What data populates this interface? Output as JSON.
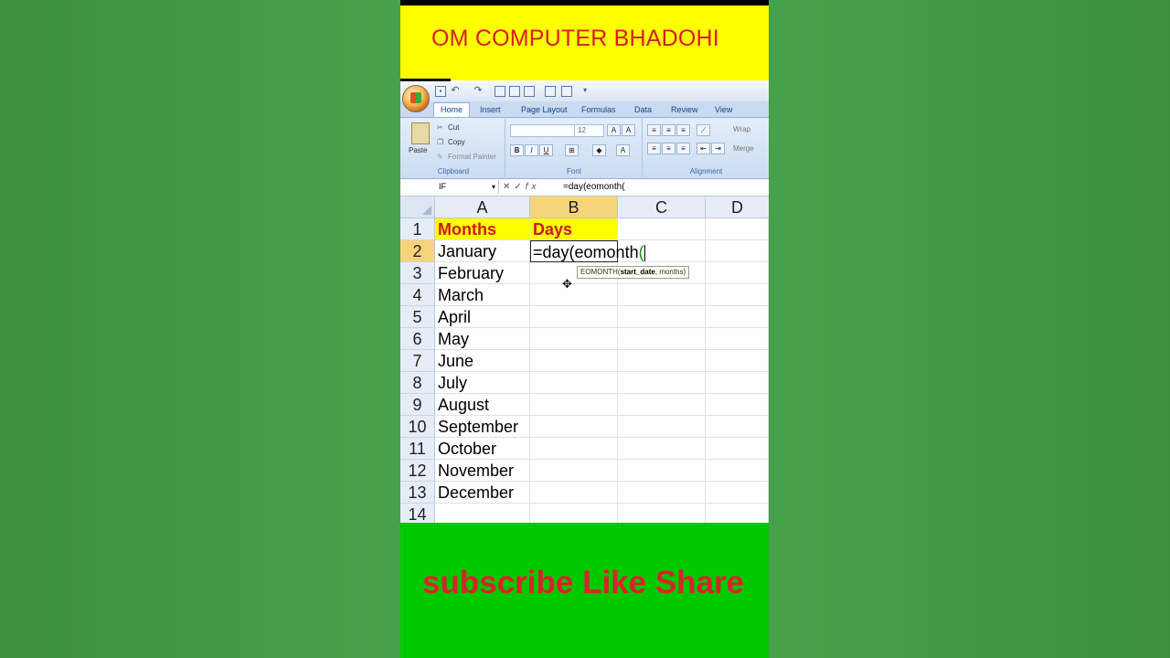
{
  "banner": {
    "title": "OM COMPUTER BHADOHI"
  },
  "ribbon": {
    "tabs": [
      "Home",
      "Insert",
      "Page Layout",
      "Formulas",
      "Data",
      "Review",
      "View"
    ],
    "clipboard": {
      "paste": "Paste",
      "cut": "Cut",
      "copy": "Copy",
      "format_painter": "Format Painter",
      "label": "Clipboard"
    },
    "font": {
      "size": "12",
      "label": "Font"
    },
    "alignment": {
      "wrap": "Wrap",
      "merge": "Merge",
      "label": "Alignment"
    }
  },
  "formula_bar": {
    "name_box": "IF",
    "formula": "=day(eomonth("
  },
  "sheet": {
    "columns": [
      "A",
      "B",
      "C",
      "D"
    ],
    "rows": [
      "1",
      "2",
      "3",
      "4",
      "5",
      "6",
      "7",
      "8",
      "9",
      "10",
      "11",
      "12",
      "13",
      "14"
    ],
    "header": {
      "a1": "Months",
      "b1": "Days"
    },
    "months": [
      "January",
      "February",
      "March",
      "April",
      "May",
      "June",
      "July",
      "August",
      "September",
      "October",
      "November",
      "December"
    ],
    "editing_text": "=day(eomonth(",
    "tooltip": {
      "fn": "EOMONTH(",
      "arg1": "start_date",
      "rest": ", months)"
    }
  },
  "footer": {
    "cta": "subscribe Like Share"
  }
}
